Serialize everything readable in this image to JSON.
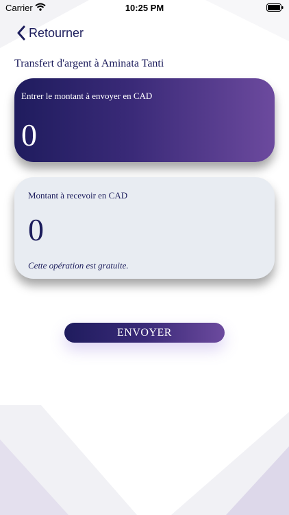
{
  "status_bar": {
    "carrier": "Carrier",
    "time": "10:25 PM"
  },
  "header": {
    "back_label": "Retourner",
    "title": "Transfert d'argent à Aminata Tanti"
  },
  "send_card": {
    "label": "Entrer le montant à envoyer en CAD",
    "amount": "0"
  },
  "receive_card": {
    "label": "Montant à recevoir en CAD",
    "amount": "0",
    "fee_note": "Cette opération est gratuite."
  },
  "actions": {
    "send_label": "ENVOYER"
  },
  "colors": {
    "primary_dark": "#1f1c5e",
    "primary_light": "#6c4a9e",
    "text": "#1c1d5c",
    "card_light": "#e8ecf2"
  }
}
